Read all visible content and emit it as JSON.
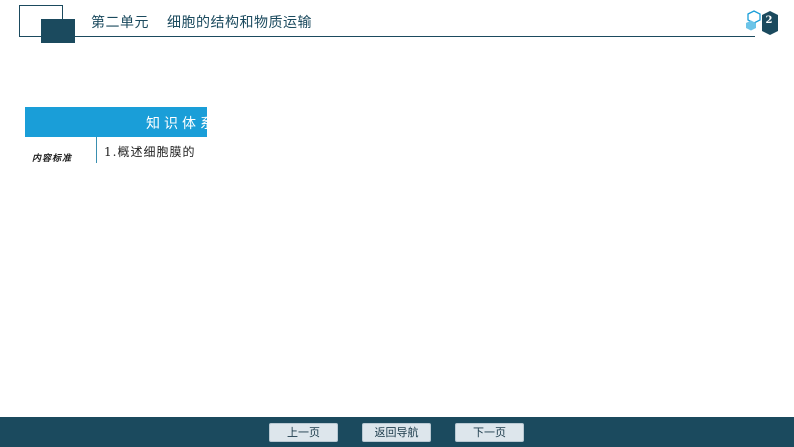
{
  "header": {
    "unit_label": "第二单元",
    "chapter_title": "细胞的结构和物质运输",
    "page_number": "2"
  },
  "card": {
    "header_label": "知识体系",
    "left_label": "内容标准",
    "item_text": "1.概述细胞膜的"
  },
  "nav": {
    "prev_label": "上一页",
    "home_label": "返回导航",
    "next_label": "下一页"
  },
  "colors": {
    "brand_dark": "#1b4a5e",
    "accent_blue": "#1a9ed8",
    "button_bg": "#dde6ec"
  }
}
